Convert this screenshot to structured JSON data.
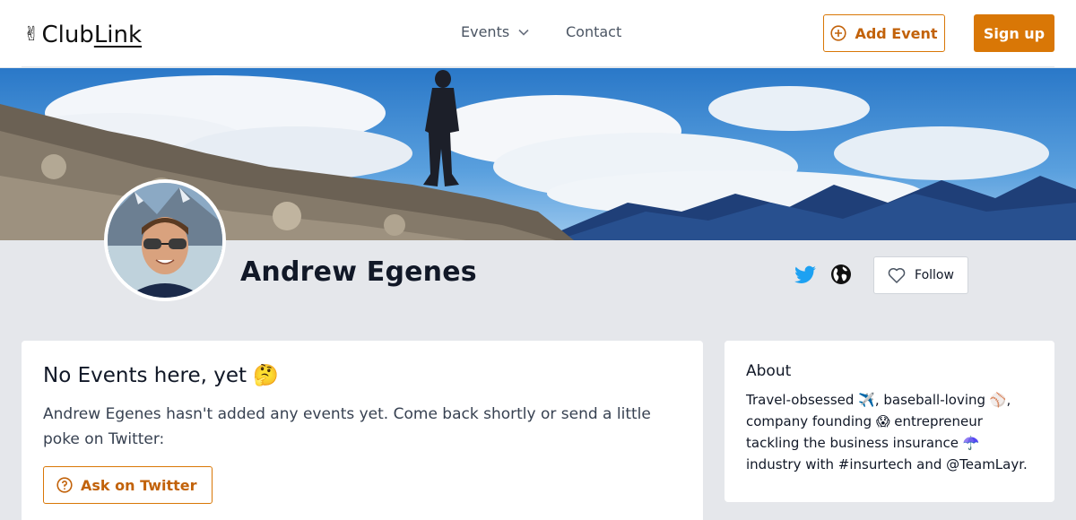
{
  "header": {
    "logo_emoji": "✌",
    "logo_word_1": "Club",
    "logo_word_2": "Link",
    "nav_events": "Events",
    "nav_contact": "Contact",
    "add_event": "Add Event",
    "sign_up": "Sign up"
  },
  "profile": {
    "name": "Andrew Egenes",
    "follow": "Follow"
  },
  "events_card": {
    "title": "No Events here, yet 🤔",
    "message": "Andrew Egenes hasn't added any events yet. Come back shortly or send a little poke on Twitter:",
    "ask_button": "Ask on Twitter"
  },
  "about_card": {
    "title": "About",
    "bio": "Travel-obsessed ✈️, baseball-loving ⚾, company founding 😱 entrepreneur tackling the business insurance ☂️ industry with #insurtech and @TeamLayr."
  },
  "colors": {
    "accent": "#d97706",
    "background": "#e5e7eb",
    "twitter": "#1da1f2"
  },
  "icons": [
    "chevron-down-icon",
    "plus-circle-icon",
    "twitter-icon",
    "globe-icon",
    "heart-icon",
    "question-circle-icon"
  ]
}
